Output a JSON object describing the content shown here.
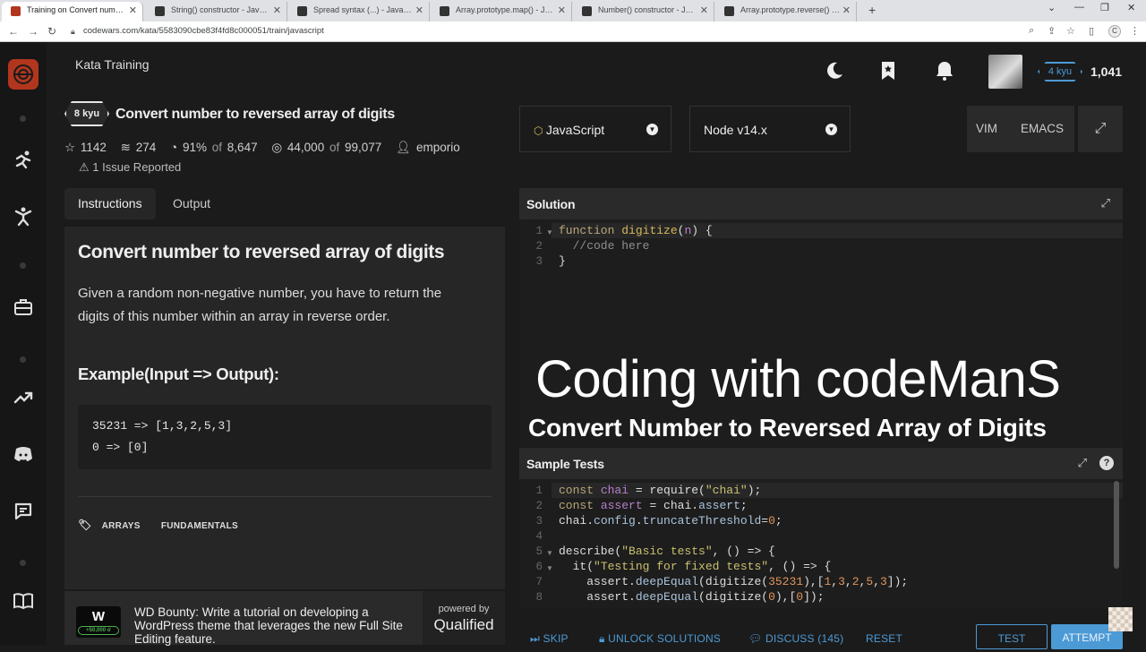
{
  "browser": {
    "tabs": [
      {
        "title": "Training on Convert number to reversed array of digits | Codewars"
      },
      {
        "title": "String() constructor - JavaScript | MDN"
      },
      {
        "title": "Spread syntax (...) - JavaScript | MDN"
      },
      {
        "title": "Array.prototype.map() - JavaScript | MDN"
      },
      {
        "title": "Number() constructor - JavaScript | MDN"
      },
      {
        "title": "Array.prototype.reverse() - JavaScript | MDN"
      }
    ],
    "url": "codewars.com/kata/5583090cbe83f4fd8c000051/train/javascript",
    "profile_initial": "C"
  },
  "header": {
    "section": "Kata Training",
    "user_rank": "4 kyu",
    "honor": "1,041"
  },
  "kata": {
    "rank": "8 kyu",
    "title": "Convert number to reversed array of digits",
    "stars": "1142",
    "collections": "274",
    "satisfaction": "91%",
    "satisfaction_of": "of",
    "votes": "8,647",
    "completed": "44,000",
    "completed_of": "of",
    "attempts": "99,077",
    "author": "emporio",
    "issues": "1 Issue Reported"
  },
  "panel_tabs": {
    "instructions": "Instructions",
    "output": "Output"
  },
  "description": {
    "heading": "Convert number to reversed array of digits",
    "text": "Given a random non-negative number, you have to return the digits of this number within an array in reverse order.",
    "example_heading": "Example(Input => Output):",
    "example_lines": [
      "35231 => [1,3,2,5,3]",
      "0 => [0]"
    ],
    "tags": [
      "ARRAYS",
      "FUNDAMENTALS"
    ]
  },
  "bounty": {
    "logo": "W",
    "logo_badge": "+50,000 σ",
    "text": "WD Bounty: Write a tutorial on developing a WordPress theme that leverages the new Full Site Editing feature.",
    "powered_by": "powered by",
    "brand": "Qualified"
  },
  "editor": {
    "language": "JavaScript",
    "runtime": "Node v14.x",
    "keymap_vim": "VIM",
    "keymap_emacs": "EMACS",
    "solution_title": "Solution",
    "solution_lines": [
      {
        "num": "1",
        "text": "function digitize(n) {"
      },
      {
        "num": "2",
        "text": "  //code here"
      },
      {
        "num": "3",
        "text": "}"
      }
    ],
    "tests_title": "Sample Tests",
    "test_lines": [
      {
        "num": "1",
        "text": "const chai = require(\"chai\");"
      },
      {
        "num": "2",
        "text": "const assert = chai.assert;"
      },
      {
        "num": "3",
        "text": "chai.config.truncateThreshold=0;"
      },
      {
        "num": "4",
        "text": ""
      },
      {
        "num": "5",
        "text": "describe(\"Basic tests\", () => {"
      },
      {
        "num": "6",
        "text": "  it(\"Testing for fixed tests\", () => {"
      },
      {
        "num": "7",
        "text": "    assert.deepEqual(digitize(35231),[1,3,2,5,3]);"
      },
      {
        "num": "8",
        "text": "    assert.deepEqual(digitize(0),[0]);"
      }
    ]
  },
  "overlay": {
    "line1": "Coding with codeManS",
    "line2": "Convert Number to Reversed Array of Digits"
  },
  "actions": {
    "skip": "SKIP",
    "unlock": "UNLOCK SOLUTIONS",
    "discuss": "DISCUSS (145)",
    "reset": "RESET",
    "test": "TEST",
    "attempt": "ATTEMPT"
  }
}
